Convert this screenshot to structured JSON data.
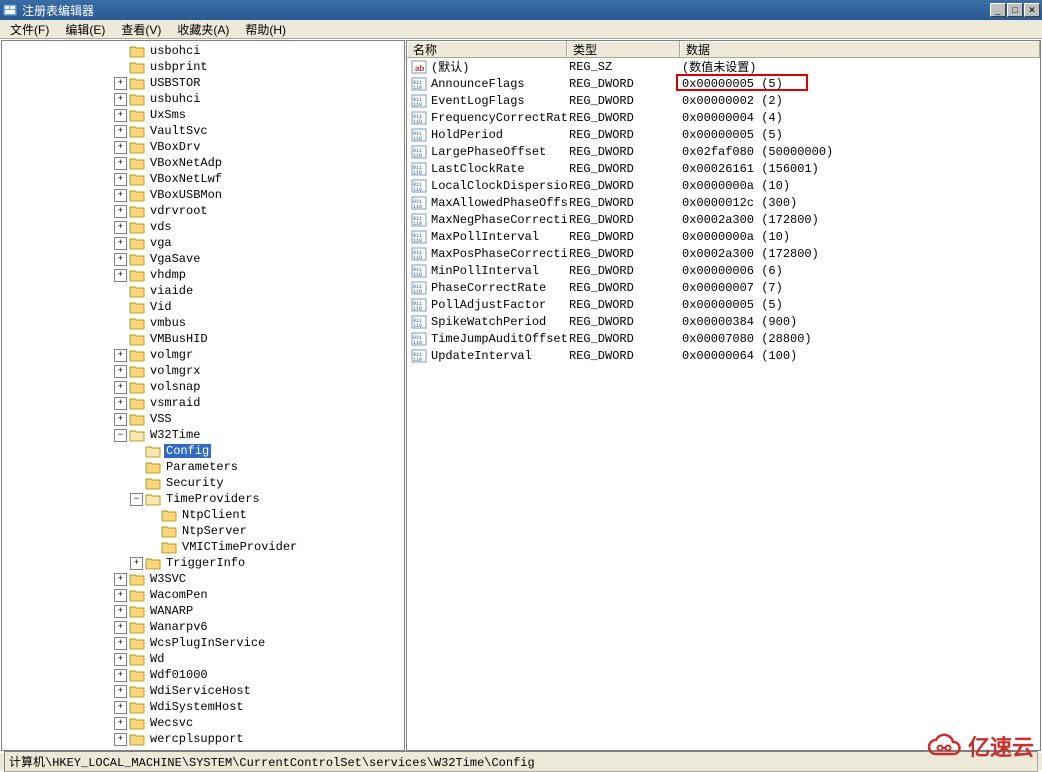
{
  "window": {
    "title": "注册表编辑器"
  },
  "menu": {
    "file": "文件(F)",
    "edit": "编辑(E)",
    "view": "查看(V)",
    "favorites": "收藏夹(A)",
    "help": "帮助(H)"
  },
  "tree": {
    "items": [
      {
        "indent": 7,
        "toggle": "none",
        "label": "usbohci"
      },
      {
        "indent": 7,
        "toggle": "none",
        "label": "usbprint"
      },
      {
        "indent": 7,
        "toggle": "plus",
        "label": "USBSTOR"
      },
      {
        "indent": 7,
        "toggle": "plus",
        "label": "usbuhci"
      },
      {
        "indent": 7,
        "toggle": "plus",
        "label": "UxSms"
      },
      {
        "indent": 7,
        "toggle": "plus",
        "label": "VaultSvc"
      },
      {
        "indent": 7,
        "toggle": "plus",
        "label": "VBoxDrv"
      },
      {
        "indent": 7,
        "toggle": "plus",
        "label": "VBoxNetAdp"
      },
      {
        "indent": 7,
        "toggle": "plus",
        "label": "VBoxNetLwf"
      },
      {
        "indent": 7,
        "toggle": "plus",
        "label": "VBoxUSBMon"
      },
      {
        "indent": 7,
        "toggle": "plus",
        "label": "vdrvroot"
      },
      {
        "indent": 7,
        "toggle": "plus",
        "label": "vds"
      },
      {
        "indent": 7,
        "toggle": "plus",
        "label": "vga"
      },
      {
        "indent": 7,
        "toggle": "plus",
        "label": "VgaSave"
      },
      {
        "indent": 7,
        "toggle": "plus",
        "label": "vhdmp"
      },
      {
        "indent": 7,
        "toggle": "none",
        "label": "viaide"
      },
      {
        "indent": 7,
        "toggle": "none",
        "label": "Vid"
      },
      {
        "indent": 7,
        "toggle": "none",
        "label": "vmbus"
      },
      {
        "indent": 7,
        "toggle": "none",
        "label": "VMBusHID"
      },
      {
        "indent": 7,
        "toggle": "plus",
        "label": "volmgr"
      },
      {
        "indent": 7,
        "toggle": "plus",
        "label": "volmgrx"
      },
      {
        "indent": 7,
        "toggle": "plus",
        "label": "volsnap"
      },
      {
        "indent": 7,
        "toggle": "plus",
        "label": "vsmraid"
      },
      {
        "indent": 7,
        "toggle": "plus",
        "label": "VSS"
      },
      {
        "indent": 7,
        "toggle": "minus",
        "label": "W32Time"
      },
      {
        "indent": 8,
        "toggle": "none",
        "label": "Config",
        "selected": true
      },
      {
        "indent": 8,
        "toggle": "none",
        "label": "Parameters"
      },
      {
        "indent": 8,
        "toggle": "none",
        "label": "Security"
      },
      {
        "indent": 8,
        "toggle": "minus",
        "label": "TimeProviders"
      },
      {
        "indent": 9,
        "toggle": "none",
        "label": "NtpClient"
      },
      {
        "indent": 9,
        "toggle": "none",
        "label": "NtpServer"
      },
      {
        "indent": 9,
        "toggle": "none",
        "label": "VMICTimeProvider"
      },
      {
        "indent": 8,
        "toggle": "plus",
        "label": "TriggerInfo"
      },
      {
        "indent": 7,
        "toggle": "plus",
        "label": "W3SVC"
      },
      {
        "indent": 7,
        "toggle": "plus",
        "label": "WacomPen"
      },
      {
        "indent": 7,
        "toggle": "plus",
        "label": "WANARP"
      },
      {
        "indent": 7,
        "toggle": "plus",
        "label": "Wanarpv6"
      },
      {
        "indent": 7,
        "toggle": "plus",
        "label": "WcsPlugInService"
      },
      {
        "indent": 7,
        "toggle": "plus",
        "label": "Wd"
      },
      {
        "indent": 7,
        "toggle": "plus",
        "label": "Wdf01000"
      },
      {
        "indent": 7,
        "toggle": "plus",
        "label": "WdiServiceHost"
      },
      {
        "indent": 7,
        "toggle": "plus",
        "label": "WdiSystemHost"
      },
      {
        "indent": 7,
        "toggle": "plus",
        "label": "Wecsvc"
      },
      {
        "indent": 7,
        "toggle": "plus",
        "label": "wercplsupport"
      }
    ]
  },
  "list": {
    "headers": {
      "name": "名称",
      "type": "类型",
      "data": "数据"
    },
    "rows": [
      {
        "icon": "sz",
        "name": "(默认)",
        "type": "REG_SZ",
        "data": "(数值未设置)"
      },
      {
        "icon": "bin",
        "name": "AnnounceFlags",
        "type": "REG_DWORD",
        "data": "0x00000005 (5)",
        "highlight": true
      },
      {
        "icon": "bin",
        "name": "EventLogFlags",
        "type": "REG_DWORD",
        "data": "0x00000002 (2)"
      },
      {
        "icon": "bin",
        "name": "FrequencyCorrectRate",
        "type": "REG_DWORD",
        "data": "0x00000004 (4)"
      },
      {
        "icon": "bin",
        "name": "HoldPeriod",
        "type": "REG_DWORD",
        "data": "0x00000005 (5)"
      },
      {
        "icon": "bin",
        "name": "LargePhaseOffset",
        "type": "REG_DWORD",
        "data": "0x02faf080 (50000000)"
      },
      {
        "icon": "bin",
        "name": "LastClockRate",
        "type": "REG_DWORD",
        "data": "0x00026161 (156001)"
      },
      {
        "icon": "bin",
        "name": "LocalClockDispersion",
        "type": "REG_DWORD",
        "data": "0x0000000a (10)"
      },
      {
        "icon": "bin",
        "name": "MaxAllowedPhaseOffset",
        "type": "REG_DWORD",
        "data": "0x0000012c (300)"
      },
      {
        "icon": "bin",
        "name": "MaxNegPhaseCorrection",
        "type": "REG_DWORD",
        "data": "0x0002a300 (172800)"
      },
      {
        "icon": "bin",
        "name": "MaxPollInterval",
        "type": "REG_DWORD",
        "data": "0x0000000a (10)"
      },
      {
        "icon": "bin",
        "name": "MaxPosPhaseCorrection",
        "type": "REG_DWORD",
        "data": "0x0002a300 (172800)"
      },
      {
        "icon": "bin",
        "name": "MinPollInterval",
        "type": "REG_DWORD",
        "data": "0x00000006 (6)"
      },
      {
        "icon": "bin",
        "name": "PhaseCorrectRate",
        "type": "REG_DWORD",
        "data": "0x00000007 (7)"
      },
      {
        "icon": "bin",
        "name": "PollAdjustFactor",
        "type": "REG_DWORD",
        "data": "0x00000005 (5)"
      },
      {
        "icon": "bin",
        "name": "SpikeWatchPeriod",
        "type": "REG_DWORD",
        "data": "0x00000384 (900)"
      },
      {
        "icon": "bin",
        "name": "TimeJumpAuditOffset",
        "type": "REG_DWORD",
        "data": "0x00007080 (28800)"
      },
      {
        "icon": "bin",
        "name": "UpdateInterval",
        "type": "REG_DWORD",
        "data": "0x00000064 (100)"
      }
    ]
  },
  "statusbar": {
    "path": "计算机\\HKEY_LOCAL_MACHINE\\SYSTEM\\CurrentControlSet\\services\\W32Time\\Config"
  },
  "watermark": {
    "text": "亿速云"
  }
}
